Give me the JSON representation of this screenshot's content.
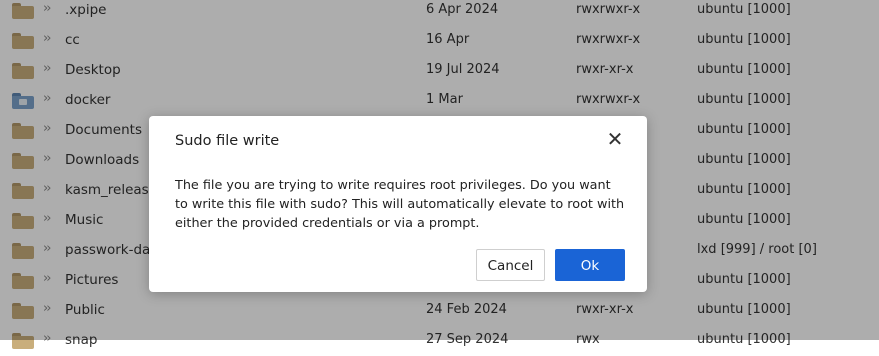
{
  "files": [
    {
      "name": ".xpipe",
      "date": "6 Apr 2024",
      "perms": "rwxrwxr-x",
      "owner": "ubuntu [1000]",
      "icon": "folder-icon"
    },
    {
      "name": "cc",
      "date": "16 Apr",
      "perms": "rwxrwxr-x",
      "owner": "ubuntu [1000]",
      "icon": "folder-icon"
    },
    {
      "name": "Desktop",
      "date": "19 Jul 2024",
      "perms": "rwxr-xr-x",
      "owner": "ubuntu [1000]",
      "icon": "folder-icon"
    },
    {
      "name": "docker",
      "date": "1 Mar",
      "perms": "rwxrwxr-x",
      "owner": "ubuntu [1000]",
      "icon": "docker-folder-icon"
    },
    {
      "name": "Documents",
      "date": "",
      "perms": "",
      "owner": "ubuntu [1000]",
      "icon": "folder-icon"
    },
    {
      "name": "Downloads",
      "date": "",
      "perms": "",
      "owner": "ubuntu [1000]",
      "icon": "folder-icon"
    },
    {
      "name": "kasm_release_",
      "date": "",
      "perms": "",
      "owner": "ubuntu [1000]",
      "icon": "folder-icon"
    },
    {
      "name": "Music",
      "date": "",
      "perms": "",
      "owner": "ubuntu [1000]",
      "icon": "folder-icon"
    },
    {
      "name": "passwork-dat",
      "date": "",
      "perms": "",
      "owner": "lxd [999] / root [0]",
      "icon": "folder-icon"
    },
    {
      "name": "Pictures",
      "date": "",
      "perms": "",
      "owner": "ubuntu [1000]",
      "icon": "folder-icon"
    },
    {
      "name": "Public",
      "date": "24 Feb 2024",
      "perms": "rwxr-xr-x",
      "owner": "ubuntu [1000]",
      "icon": "folder-icon"
    },
    {
      "name": "snap",
      "date": "27 Sep 2024",
      "perms": "rwx",
      "owner": "ubuntu [1000]",
      "icon": "folder-icon"
    }
  ],
  "dialog": {
    "title": "Sudo file write",
    "message": "The file you are trying to write requires root privileges. Do you want to write this file with sudo? This will automatically elevate to root with either the provided credentials or via a prompt.",
    "cancel_label": "Cancel",
    "ok_label": "Ok",
    "close_glyph": "✕",
    "close_icon": "close-icon"
  },
  "colors": {
    "primary": "#1a64d6",
    "folder": "#c9ae7c",
    "docker_folder": "#7da3cc",
    "overlay": "rgba(0,0,0,0.32)"
  }
}
